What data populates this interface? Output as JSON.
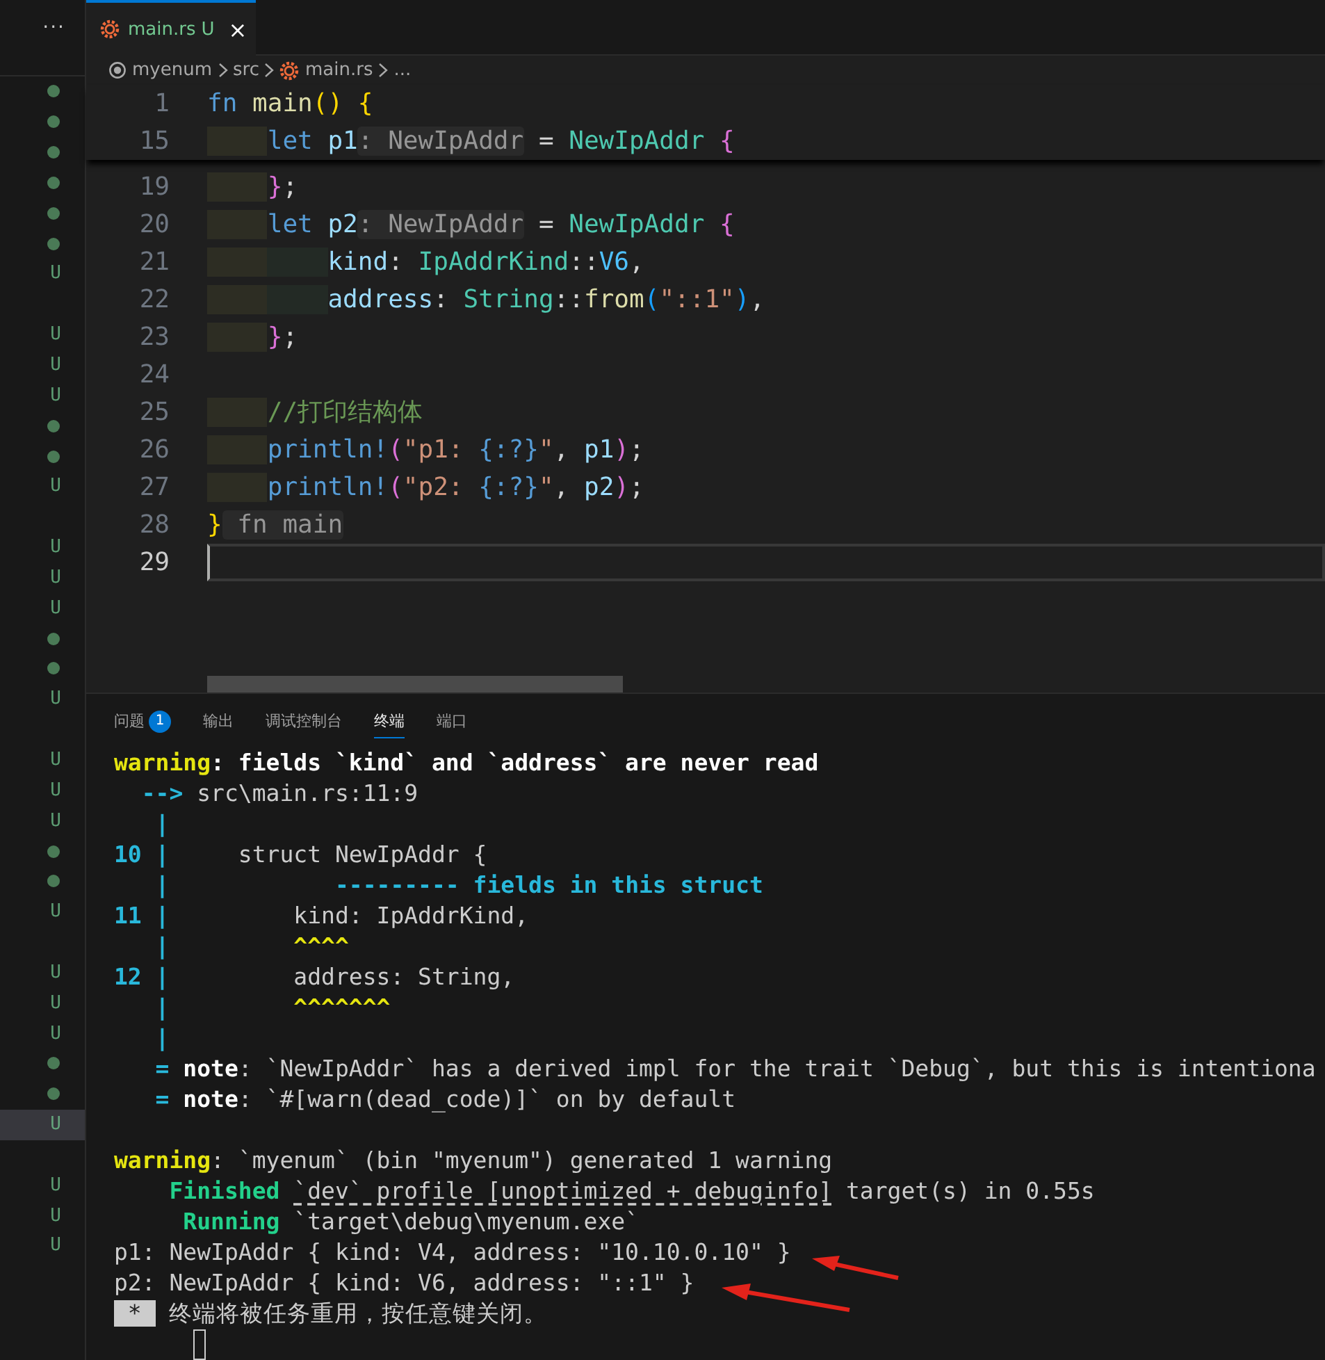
{
  "sidebar": {
    "more": "···",
    "markers": [
      {
        "kind": "dot",
        "selected": false
      },
      {
        "kind": "dot",
        "selected": false
      },
      {
        "kind": "dot",
        "selected": false
      },
      {
        "kind": "dot",
        "selected": false
      },
      {
        "kind": "dot",
        "selected": false
      },
      {
        "kind": "dot",
        "selected": false
      },
      {
        "kind": "letter",
        "text": "U",
        "selected": false
      },
      {
        "kind": "blank",
        "selected": false
      },
      {
        "kind": "letter",
        "text": "U",
        "selected": false
      },
      {
        "kind": "letter",
        "text": "U",
        "selected": false
      },
      {
        "kind": "letter",
        "text": "U",
        "selected": false
      },
      {
        "kind": "dot",
        "selected": false
      },
      {
        "kind": "dot",
        "selected": false
      },
      {
        "kind": "letter",
        "text": "U",
        "selected": false
      },
      {
        "kind": "blank",
        "selected": false
      },
      {
        "kind": "letter",
        "text": "U",
        "selected": false
      },
      {
        "kind": "letter",
        "text": "U",
        "selected": false
      },
      {
        "kind": "letter",
        "text": "U",
        "selected": false
      },
      {
        "kind": "dot",
        "selected": false
      },
      {
        "kind": "dot",
        "selected": false
      },
      {
        "kind": "letter",
        "text": "U",
        "selected": false
      },
      {
        "kind": "blank",
        "selected": false
      },
      {
        "kind": "letter",
        "text": "U",
        "selected": false
      },
      {
        "kind": "letter",
        "text": "U",
        "selected": false
      },
      {
        "kind": "letter",
        "text": "U",
        "selected": false
      },
      {
        "kind": "dot",
        "selected": false
      },
      {
        "kind": "dot",
        "selected": false
      },
      {
        "kind": "letter",
        "text": "U",
        "selected": false
      },
      {
        "kind": "blank",
        "selected": false
      },
      {
        "kind": "letter",
        "text": "U",
        "selected": false
      },
      {
        "kind": "letter",
        "text": "U",
        "selected": false
      },
      {
        "kind": "letter",
        "text": "U",
        "selected": false
      },
      {
        "kind": "dot",
        "selected": false
      },
      {
        "kind": "dot",
        "selected": false
      },
      {
        "kind": "letter",
        "text": "U",
        "selected": true
      },
      {
        "kind": "blank",
        "selected": false
      },
      {
        "kind": "letter",
        "text": "U",
        "selected": false
      },
      {
        "kind": "letter",
        "text": "U",
        "selected": false
      },
      {
        "kind": "letter",
        "text": "U",
        "selected": false
      }
    ]
  },
  "editor_tab": {
    "label": "main.rs",
    "status": "U",
    "close": "×"
  },
  "breadcrumb": [
    "myenum",
    "src",
    "main.rs",
    "..."
  ],
  "sticky_lines": [
    {
      "number": "1",
      "tokens": [
        {
          "text": "fn ",
          "kind": "keyword"
        },
        {
          "text": "main",
          "kind": "function"
        },
        {
          "text": "()",
          "kind": "bracket1"
        },
        {
          "text": " {",
          "kind": "bracket1"
        }
      ]
    },
    {
      "number": "15",
      "tokens": [
        {
          "text": "    let",
          "kind": "keyword"
        },
        {
          "text": " p1",
          "kind": "variable"
        },
        {
          "text": ": NewIpAddr",
          "kind": "hint"
        },
        {
          "text": " = ",
          "kind": "punct"
        },
        {
          "text": "NewIpAddr",
          "kind": "type"
        },
        {
          "text": " {",
          "kind": "bracket2"
        }
      ]
    }
  ],
  "code_lines": [
    {
      "number": "19",
      "current": false,
      "tokens": [
        {
          "text": "    }",
          "kind": "bracket2"
        },
        {
          "text": ";",
          "kind": "punct"
        }
      ]
    },
    {
      "number": "20",
      "current": false,
      "tokens": [
        {
          "text": "    let",
          "kind": "keyword"
        },
        {
          "text": " p2",
          "kind": "variable"
        },
        {
          "text": ": NewIpAddr",
          "kind": "hint"
        },
        {
          "text": " = ",
          "kind": "punct"
        },
        {
          "text": "NewIpAddr",
          "kind": "type"
        },
        {
          "text": " {",
          "kind": "bracket2"
        }
      ]
    },
    {
      "number": "21",
      "current": false,
      "tokens": [
        {
          "text": "        kind",
          "kind": "variable"
        },
        {
          "text": ": ",
          "kind": "punct"
        },
        {
          "text": "IpAddrKind",
          "kind": "type"
        },
        {
          "text": "::",
          "kind": "punct"
        },
        {
          "text": "V6",
          "kind": "constant"
        },
        {
          "text": ",",
          "kind": "punct"
        }
      ]
    },
    {
      "number": "22",
      "current": false,
      "tokens": [
        {
          "text": "        address",
          "kind": "variable"
        },
        {
          "text": ": ",
          "kind": "punct"
        },
        {
          "text": "String",
          "kind": "type"
        },
        {
          "text": "::",
          "kind": "punct"
        },
        {
          "text": "from",
          "kind": "function"
        },
        {
          "text": "(",
          "kind": "bracket3"
        },
        {
          "text": "\"::1\"",
          "kind": "string"
        },
        {
          "text": ")",
          "kind": "bracket3"
        },
        {
          "text": ",",
          "kind": "punct"
        }
      ]
    },
    {
      "number": "23",
      "current": false,
      "tokens": [
        {
          "text": "    }",
          "kind": "bracket2"
        },
        {
          "text": ";",
          "kind": "punct"
        }
      ]
    },
    {
      "number": "24",
      "current": false
    },
    {
      "number": "25",
      "current": false,
      "tokens": [
        {
          "text": "    //打印结构体",
          "kind": "comment"
        }
      ]
    },
    {
      "number": "26",
      "current": false,
      "tokens": [
        {
          "text": "    println!",
          "kind": "keyword"
        },
        {
          "text": "(",
          "kind": "bracket2"
        },
        {
          "text": "\"p1: ",
          "kind": "string"
        },
        {
          "text": "{:?}",
          "kind": "keyword"
        },
        {
          "text": "\"",
          "kind": "string"
        },
        {
          "text": ", ",
          "kind": "punct"
        },
        {
          "text": "p1",
          "kind": "variable"
        },
        {
          "text": ")",
          "kind": "bracket2"
        },
        {
          "text": ";",
          "kind": "punct"
        }
      ]
    },
    {
      "number": "27",
      "current": false,
      "tokens": [
        {
          "text": "    println!",
          "kind": "keyword"
        },
        {
          "text": "(",
          "kind": "bracket2"
        },
        {
          "text": "\"p2: ",
          "kind": "string"
        },
        {
          "text": "{:?}",
          "kind": "keyword"
        },
        {
          "text": "\"",
          "kind": "string"
        },
        {
          "text": ", ",
          "kind": "punct"
        },
        {
          "text": "p2",
          "kind": "variable"
        },
        {
          "text": ")",
          "kind": "bracket2"
        },
        {
          "text": ";",
          "kind": "punct"
        }
      ]
    },
    {
      "number": "28",
      "current": false,
      "tokens": [
        {
          "text": "}",
          "kind": "bracket1"
        },
        {
          "text": " fn main",
          "kind": "hint"
        }
      ]
    },
    {
      "number": "29",
      "current": true
    }
  ],
  "panel": {
    "tabs": [
      {
        "label": "问题",
        "badge": "1",
        "selected": false
      },
      {
        "label": "输出",
        "selected": false
      },
      {
        "label": "调试控制台",
        "selected": false
      },
      {
        "label": "终端",
        "selected": true
      },
      {
        "label": "端口",
        "selected": false
      }
    ],
    "terminal_lines": [
      {
        "kind": "text",
        "tokens": [
          {
            "text": "warning",
            "kind": "warn"
          },
          {
            "text": ": fields `kind` and `address` are never read",
            "kind": "strong"
          }
        ]
      },
      {
        "kind": "text",
        "tokens": [
          {
            "text": "  --> ",
            "kind": "info"
          },
          {
            "text": "src\\main.rs:11:9",
            "kind": "plain"
          }
        ]
      },
      {
        "kind": "text",
        "tokens": [
          {
            "text": "   |",
            "kind": "info"
          }
        ]
      },
      {
        "kind": "text",
        "tokens": [
          {
            "text": "10 |",
            "kind": "info"
          },
          {
            "text": "     struct NewIpAddr {",
            "kind": "plain"
          }
        ]
      },
      {
        "kind": "text",
        "tokens": [
          {
            "text": "   |",
            "kind": "info"
          },
          {
            "text": "            --------- fields in this struct",
            "kind": "info"
          }
        ]
      },
      {
        "kind": "text",
        "tokens": [
          {
            "text": "11 |",
            "kind": "info"
          },
          {
            "text": "         kind: IpAddrKind,",
            "kind": "plain"
          }
        ]
      },
      {
        "kind": "text",
        "tokens": [
          {
            "text": "   |",
            "kind": "info"
          },
          {
            "text": "         ^^^^",
            "kind": "warn"
          }
        ]
      },
      {
        "kind": "text",
        "tokens": [
          {
            "text": "12 |",
            "kind": "info"
          },
          {
            "text": "         address: String,",
            "kind": "plain"
          }
        ]
      },
      {
        "kind": "text",
        "tokens": [
          {
            "text": "   |",
            "kind": "info"
          },
          {
            "text": "         ^^^^^^^",
            "kind": "warn"
          }
        ]
      },
      {
        "kind": "text",
        "tokens": [
          {
            "text": "   |",
            "kind": "info"
          }
        ]
      },
      {
        "kind": "text",
        "tokens": [
          {
            "text": "   = ",
            "kind": "info"
          },
          {
            "text": "note",
            "kind": "strong"
          },
          {
            "text": ": `NewIpAddr` has a derived impl for the trait `Debug`, but this is intentiona",
            "kind": "plain"
          }
        ]
      },
      {
        "kind": "text",
        "tokens": [
          {
            "text": "   = ",
            "kind": "info"
          },
          {
            "text": "note",
            "kind": "strong"
          },
          {
            "text": ": `#[warn(dead_code)]` on by default",
            "kind": "plain"
          }
        ]
      },
      {
        "kind": "blank"
      },
      {
        "kind": "text",
        "tokens": [
          {
            "text": "warning",
            "kind": "warn"
          },
          {
            "text": ": `myenum` (bin \"myenum\") generated 1 warning",
            "kind": "plain"
          }
        ]
      },
      {
        "kind": "text",
        "tokens": [
          {
            "text": "    Finished ",
            "kind": "success"
          },
          {
            "text": "`dev` profile [unoptimized + debuginfo]",
            "kind": "link"
          },
          {
            "text": " target(s) in 0.55s",
            "kind": "plain"
          }
        ]
      },
      {
        "kind": "text",
        "tokens": [
          {
            "text": "     Running",
            "kind": "success"
          },
          {
            "text": " `target\\debug\\myenum.exe`",
            "kind": "plain"
          }
        ]
      },
      {
        "kind": "text",
        "tokens": [
          {
            "text": "p1: NewIpAddr { kind: V4, address: \"10.10.0.10\" }",
            "kind": "plain"
          }
        ]
      },
      {
        "kind": "text",
        "tokens": [
          {
            "text": "p2: NewIpAddr { kind: V6, address: \"::1\" }",
            "kind": "plain"
          }
        ]
      },
      {
        "kind": "text",
        "tokens": [
          {
            "text": " * ",
            "kind": "prompt"
          },
          {
            "text": " 终端将被任务重用，按任意键关闭。",
            "kind": "plain"
          }
        ]
      }
    ]
  }
}
